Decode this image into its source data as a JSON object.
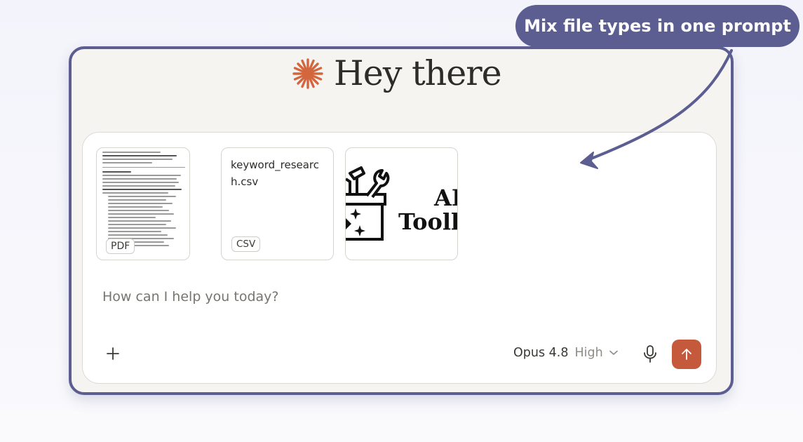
{
  "callout": {
    "text": "Mix file types in one prompt"
  },
  "greeting": {
    "icon": "sparkle-icon",
    "text": "Hey there",
    "accent_color": "#d4663e"
  },
  "attachments": [
    {
      "type_badge": "PDF",
      "icon": "document-thumbnail"
    },
    {
      "file_name": "keyword_research.csv",
      "type_badge": "CSV"
    },
    {
      "preview_text_line1": "AI",
      "preview_text_line2": "Tooll",
      "icon": "toolbox-image"
    }
  ],
  "composer": {
    "placeholder": "How can I help you today?",
    "add_icon": "plus-icon",
    "model": "Opus 4.8",
    "effort": "High",
    "mic_icon": "microphone-icon",
    "send_icon": "arrow-up-icon",
    "send_color": "#c4593b"
  },
  "colors": {
    "frame": "#5c5d91",
    "background": "#f5f4f1"
  }
}
